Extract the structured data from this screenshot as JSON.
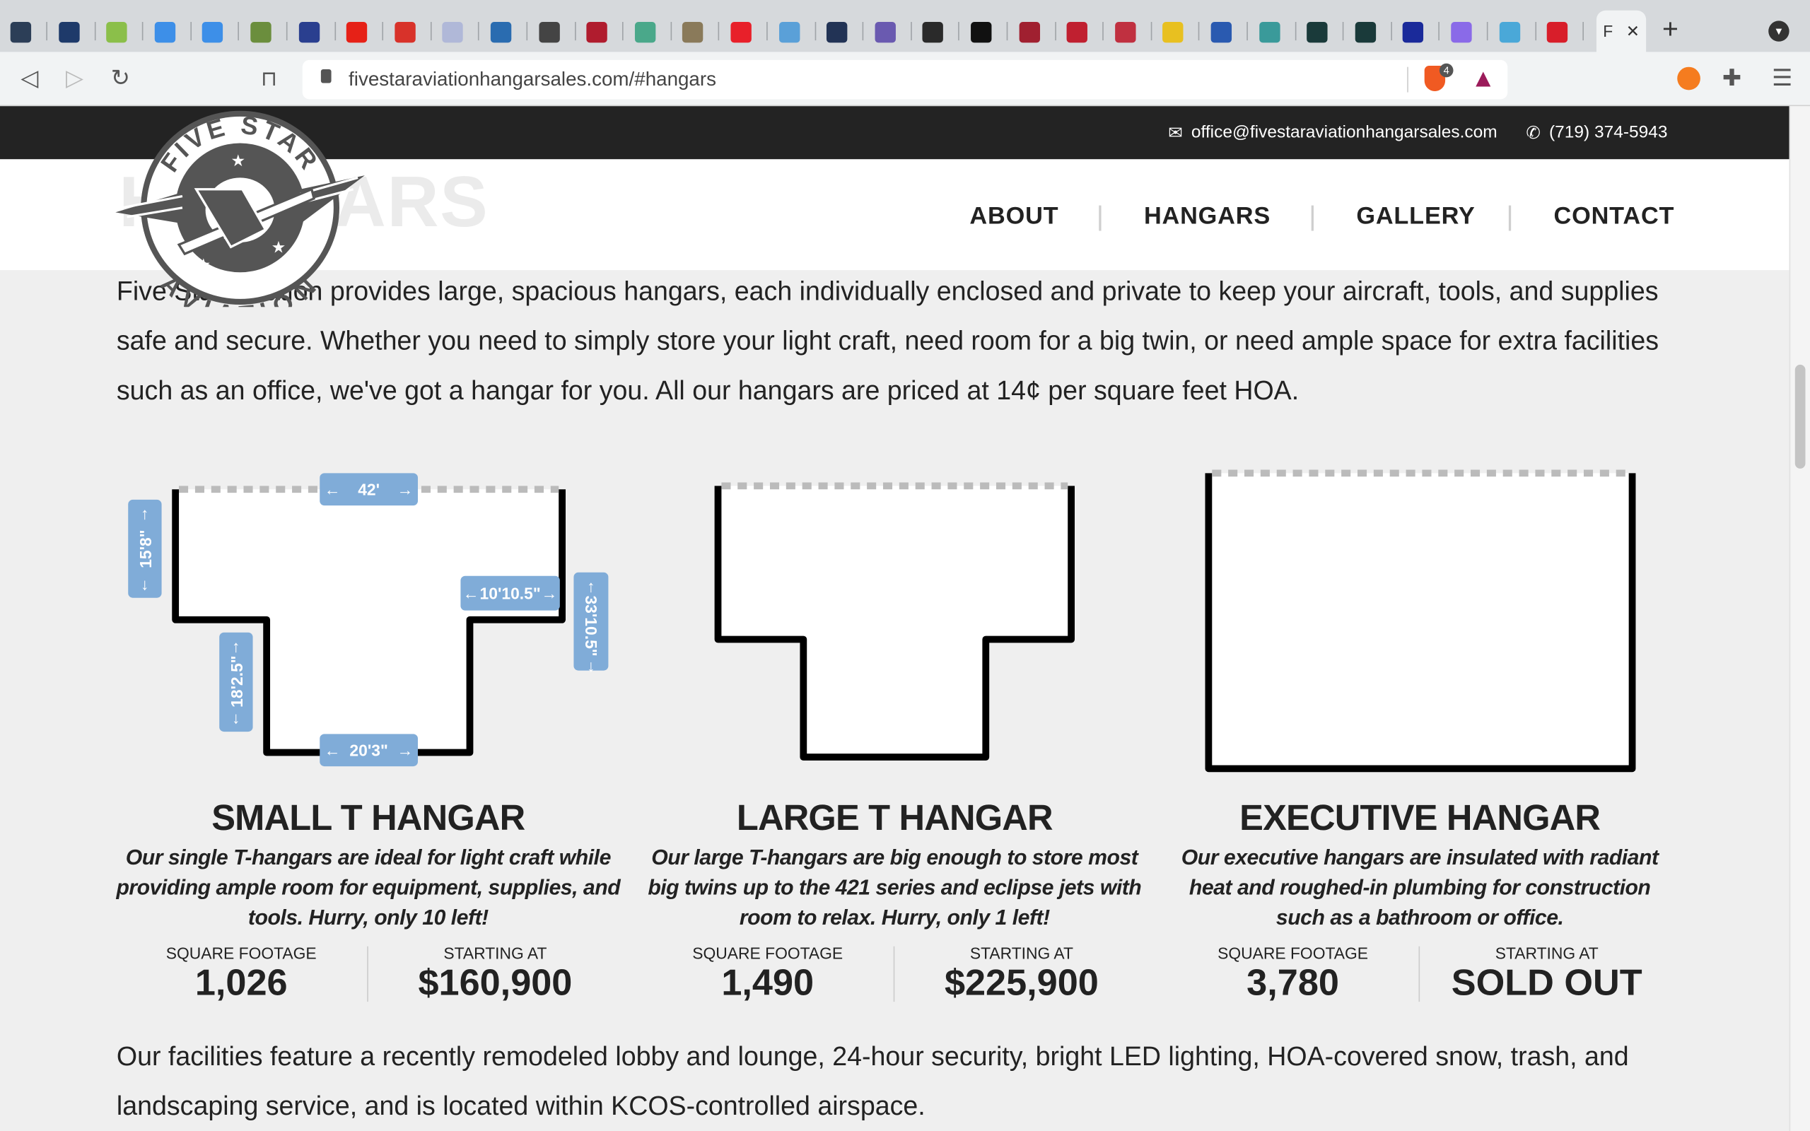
{
  "browser": {
    "tabs": [
      {
        "icon": "landscape-favicon",
        "color": "#2c3e57"
      },
      {
        "icon": "shield-favicon",
        "color": "#1e3a6a"
      },
      {
        "icon": "plant-favicon",
        "color": "#8bbf4a"
      },
      {
        "icon": "w-favicon",
        "color": "#3d8fe8"
      },
      {
        "icon": "w-favicon",
        "color": "#3d8fe8"
      },
      {
        "icon": "house-favicon",
        "color": "#6b8e3d"
      },
      {
        "icon": "af-favicon",
        "color": "#2a3f8f"
      },
      {
        "icon": "youtube-favicon",
        "color": "#e62117"
      },
      {
        "icon": "red-box-favicon",
        "color": "#d8322a"
      },
      {
        "icon": "flag-favicon",
        "color": "#b0b8d8"
      },
      {
        "icon": "a-favicon",
        "color": "#2a6cb0"
      },
      {
        "icon": "aopa-favicon",
        "color": "#444"
      },
      {
        "icon": "e-favicon",
        "color": "#b01c2e"
      },
      {
        "icon": "cart-favicon",
        "color": "#4aa88a"
      },
      {
        "icon": "photo-favicon",
        "color": "#8a7a5a"
      },
      {
        "icon": "red-bar-favicon",
        "color": "#e8202a"
      },
      {
        "icon": "bw-favicon",
        "color": "#5aa0d8"
      },
      {
        "icon": "m-favicon",
        "color": "#223355"
      },
      {
        "icon": "plane-favicon",
        "color": "#6a5ab0"
      },
      {
        "icon": "badge-favicon",
        "color": "#2a2a2a"
      },
      {
        "icon": "d-favicon",
        "color": "#111"
      },
      {
        "icon": "circle-favicon",
        "color": "#a02030"
      },
      {
        "icon": "x-favicon",
        "color": "#c02030"
      },
      {
        "icon": "logo-favicon",
        "color": "#c03040"
      },
      {
        "icon": "yellow-favicon",
        "color": "#e8c020"
      },
      {
        "icon": "ac-favicon",
        "color": "#2a5ab0"
      },
      {
        "icon": "cup-favicon",
        "color": "#3a9a9a"
      },
      {
        "icon": "tower-favicon",
        "color": "#1a3a3a"
      },
      {
        "icon": "tower-favicon",
        "color": "#1a3a3a"
      },
      {
        "icon": "jet-favicon",
        "color": "#1a2a9a"
      },
      {
        "icon": "mail-favicon",
        "color": "#8a6ae8"
      },
      {
        "icon": "hand-favicon",
        "color": "#4aa8d8"
      },
      {
        "icon": "h-favicon",
        "color": "#d81e2a"
      }
    ],
    "active_tab": {
      "label": "F",
      "close": "✕"
    },
    "new_tab": "+",
    "url": "fivestaraviationhangarsales.com/#hangars",
    "brave_badge": "4"
  },
  "topbar": {
    "email": "office@fivestaraviationhangarsales.com",
    "phone": "(719) 374-5943"
  },
  "logo": {
    "top_text": "FIVE STAR",
    "bottom_text": "AVIATION"
  },
  "section_ghost_title": "HANGARS",
  "nav": [
    {
      "label": "ABOUT"
    },
    {
      "label": "HANGARS"
    },
    {
      "label": "GALLERY"
    },
    {
      "label": "CONTACT"
    }
  ],
  "intro": "Five Star Aviation provides large, spacious hangars, each individually enclosed and private to keep your aircraft, tools, and supplies safe and secure. Whether you need to simply store your light craft, need room for a big twin, or need ample space for extra facilities such as an office, we've got a hangar for you. All our hangars are priced at 14¢ per square feet HOA.",
  "dimensions": {
    "top": "42'",
    "left": "15'8\"",
    "stem_left": "18'2.5\"",
    "bottom": "20'3\"",
    "wing": "10'10.5\"",
    "right": "33'10.5\""
  },
  "hangars": [
    {
      "name": "SMALL T HANGAR",
      "description": "Our single T-hangars are ideal for light craft while providing ample room for equipment, supplies, and tools. Hurry, only 10 left!",
      "sqft_label": "SQUARE FOOTAGE",
      "sqft": "1,026",
      "price_label": "STARTING AT",
      "price": "$160,900"
    },
    {
      "name": "LARGE T HANGAR",
      "description": "Our large T-hangars are big enough to store most big twins up to the 421 series and eclipse jets with room to relax. Hurry, only 1 left!",
      "sqft_label": "SQUARE FOOTAGE",
      "sqft": "1,490",
      "price_label": "STARTING AT",
      "price": "$225,900"
    },
    {
      "name": "EXECUTIVE HANGAR",
      "description": "Our executive hangars are insulated with radiant heat and roughed-in plumbing for construction such as a bathroom or office.",
      "sqft_label": "SQUARE FOOTAGE",
      "sqft": "3,780",
      "price_label": "STARTING AT",
      "price": "SOLD OUT"
    }
  ],
  "outro": "Our facilities feature a recently remodeled lobby and lounge, 24-hour security, bright LED lighting, HOA-covered snow, trash, and landscaping service, and is located within KCOS-controlled airspace.",
  "colors": {
    "label_blue": "#80acd8",
    "topbar": "#232323",
    "text": "#222222"
  }
}
